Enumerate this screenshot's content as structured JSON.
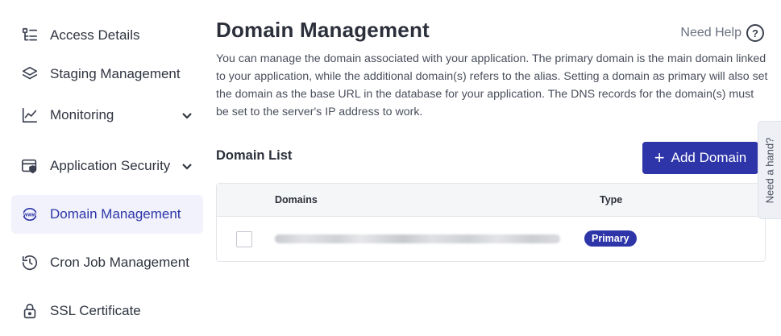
{
  "sidebar": {
    "items": [
      {
        "label": "Access Details",
        "icon": "access-details-icon"
      },
      {
        "label": "Staging Management",
        "icon": "layers-icon"
      },
      {
        "label": "Monitoring",
        "icon": "chart-line-icon"
      },
      {
        "label": "Application Security",
        "icon": "shield-browser-icon"
      },
      {
        "label": "Domain Management",
        "icon": "www-globe-icon"
      },
      {
        "label": "Cron Job Management",
        "icon": "history-clock-icon"
      },
      {
        "label": "SSL Certificate",
        "icon": "lock-icon"
      }
    ]
  },
  "main": {
    "title": "Domain Management",
    "help_label": "Need Help",
    "description": "You can manage the domain associated with your application. The primary domain is the main domain linked to your application, while the additional domain(s) refers to the alias. Setting a domain as primary will also set the domain as the base URL in the database for your application. The DNS records for the domain(s) must be set to the server's IP address to work.",
    "list_title": "Domain List",
    "add_button": "Add Domain",
    "table": {
      "columns": [
        "Domains",
        "Type"
      ],
      "rows": [
        {
          "domain": "",
          "type": "Primary"
        }
      ]
    }
  },
  "floating": {
    "need_hand": "Need a hand?"
  },
  "colors": {
    "accent": "#2d35a8",
    "active_bg": "#f1f2fb"
  }
}
